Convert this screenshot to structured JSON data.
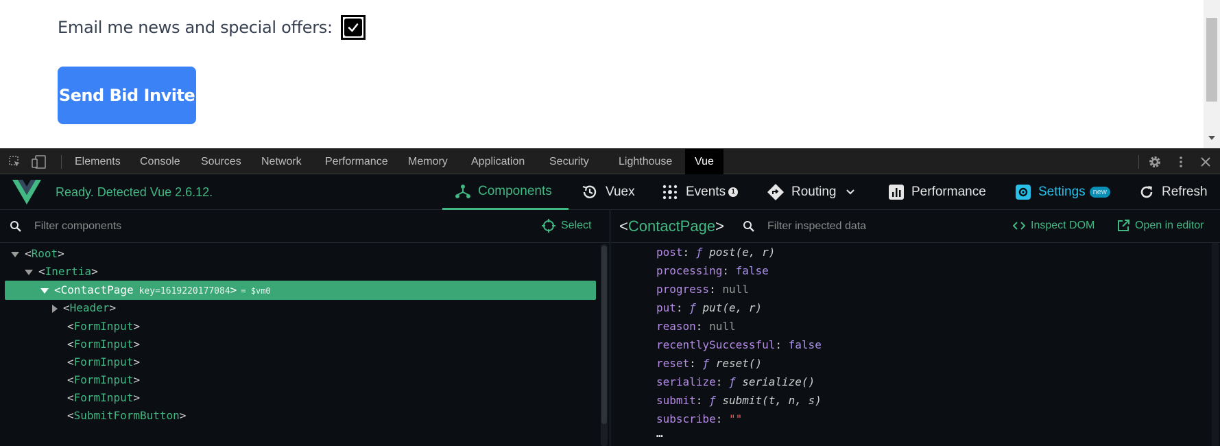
{
  "page": {
    "email_label": "Email me news and special offers:",
    "email_checked": true,
    "send_button": "Send Bid Invite"
  },
  "devtools": {
    "tabs": [
      "Elements",
      "Console",
      "Sources",
      "Network",
      "Performance",
      "Memory",
      "Application",
      "Security",
      "Lighthouse",
      "Vue"
    ],
    "active_tab": "Vue"
  },
  "vue": {
    "status": "Ready. Detected Vue 2.6.12.",
    "nav": {
      "components": "Components",
      "vuex": "Vuex",
      "events": "Events",
      "events_count": "1",
      "routing": "Routing",
      "performance": "Performance",
      "settings": "Settings",
      "settings_badge": "new",
      "refresh": "Refresh"
    },
    "colors": {
      "accent": "#42b883",
      "settings": "#28bfe8"
    },
    "left": {
      "filter_placeholder": "Filter components",
      "select_label": "Select"
    },
    "tree": {
      "root": "Root",
      "inertia": "Inertia",
      "contact_page": "ContactPage",
      "contact_key": "key=1619220177084",
      "vm_ref": "= $vm0",
      "header": "Header",
      "form_input": "FormInput",
      "submit_button": "SubmitFormButton"
    },
    "right": {
      "component_name": "ContactPage",
      "filter_placeholder": "Filter inspected data",
      "inspect_dom": "Inspect DOM",
      "open_in_editor": "Open in editor"
    },
    "props": [
      {
        "key": "post",
        "type": "fn",
        "value": "post(e, r)"
      },
      {
        "key": "processing",
        "type": "bool",
        "value": "false"
      },
      {
        "key": "progress",
        "type": "null",
        "value": "null"
      },
      {
        "key": "put",
        "type": "fn",
        "value": "put(e, r)"
      },
      {
        "key": "reason",
        "type": "null",
        "value": "null"
      },
      {
        "key": "recentlySuccessful",
        "type": "bool",
        "value": "false"
      },
      {
        "key": "reset",
        "type": "fn",
        "value": "reset()"
      },
      {
        "key": "serialize",
        "type": "fn",
        "value": "serialize()"
      },
      {
        "key": "submit",
        "type": "fn",
        "value": "submit(t, n, s)"
      },
      {
        "key": "subscribe",
        "type": "str",
        "value": "\"\""
      }
    ],
    "ellipsis": "…"
  }
}
